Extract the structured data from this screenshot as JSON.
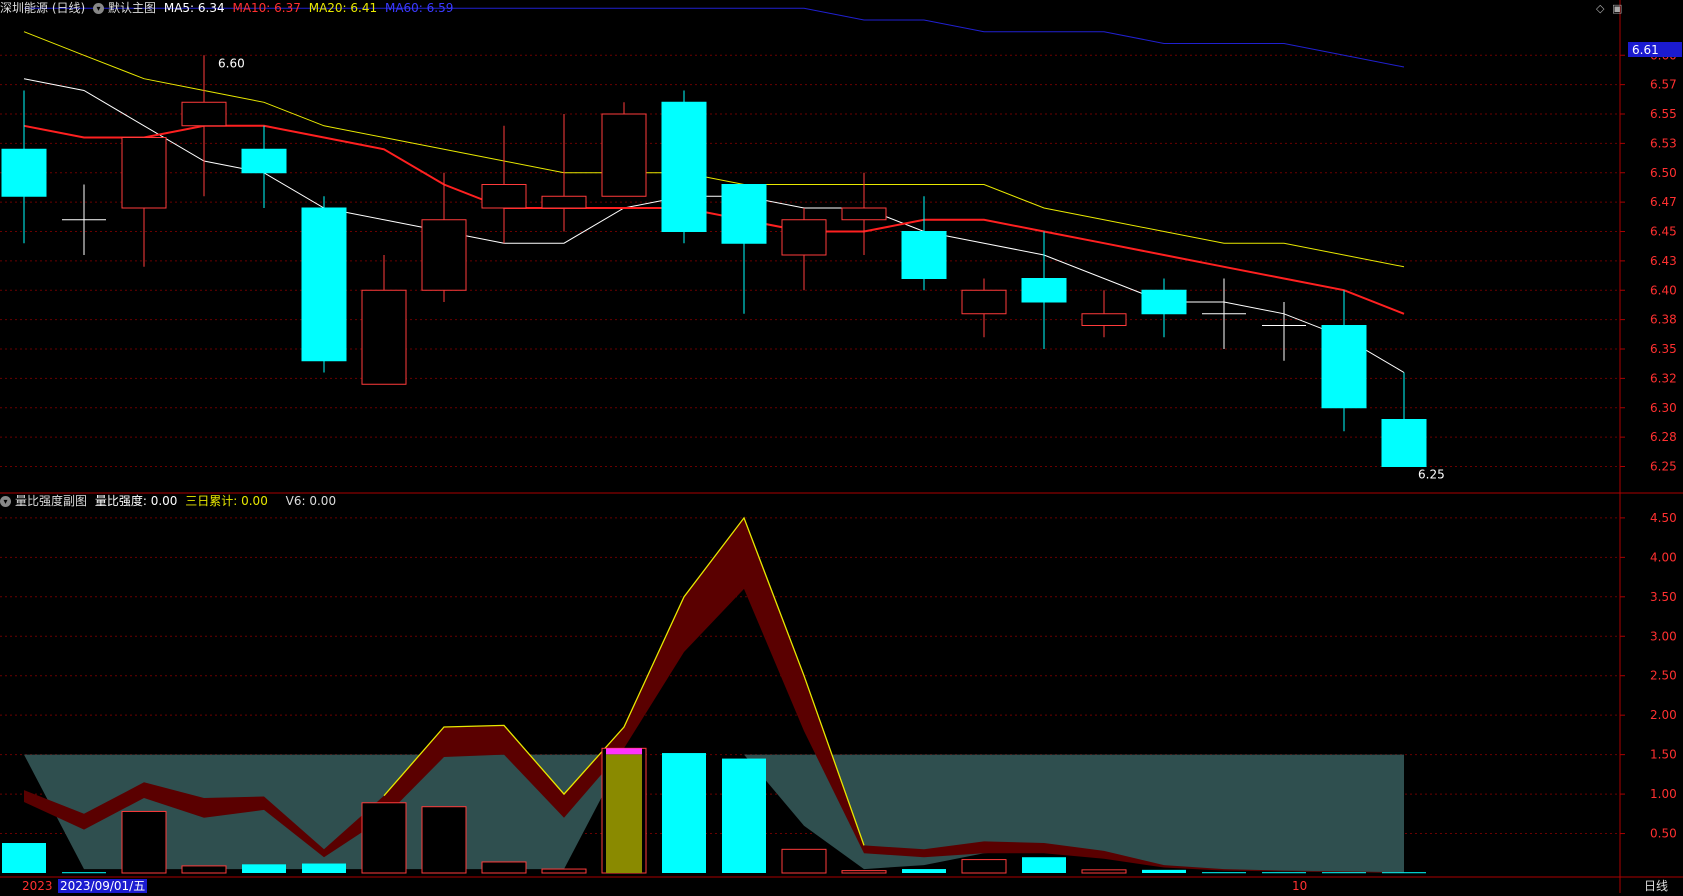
{
  "main_header": {
    "title": "深圳能源 (日线)",
    "chart_name": "默认主图",
    "ma5_label": "MA5: 6.34",
    "ma10_label": "MA10: 6.37",
    "ma20_label": "MA20: 6.41",
    "ma60_label": "MA60: 6.59"
  },
  "sub_header": {
    "title": "量比强度副图",
    "strength_label": "量比强度: 0.00",
    "three_day_label": "三日累计: 0.00",
    "v6_label": "V6: 0.00"
  },
  "colors": {
    "up": "#ff3b3b",
    "down": "#00ffff",
    "ma5": "#ffffff",
    "ma10": "#ff2020",
    "ma20": "#e8e800",
    "ma60": "#2020d0",
    "grid": "#6a0000",
    "band_fill": "#2f4f4f",
    "area_fill": "#5a0000",
    "area_line": "#e8e800"
  },
  "bottom_bar": {
    "year_label": "2023",
    "date_label": "2023/09/01/五",
    "month_label": "10",
    "period_label": "日线"
  },
  "current_price_tag": "6.61",
  "chart_data": [
    {
      "type": "candlestick",
      "title": "默认主图",
      "ylim": [
        6.23,
        6.63
      ],
      "y_ticks": [
        "6.60",
        "6.57",
        "6.55",
        "6.53",
        "6.50",
        "6.47",
        "6.45",
        "6.43",
        "6.40",
        "6.38",
        "6.35",
        "6.32",
        "6.30",
        "6.28",
        "6.25"
      ],
      "y_tick_values": [
        6.6,
        6.575,
        6.55,
        6.525,
        6.5,
        6.475,
        6.45,
        6.425,
        6.4,
        6.375,
        6.35,
        6.325,
        6.3,
        6.275,
        6.25
      ],
      "candles": [
        {
          "o": 6.52,
          "h": 6.57,
          "l": 6.44,
          "c": 6.48
        },
        {
          "o": 6.46,
          "h": 6.49,
          "l": 6.43,
          "c": 6.46
        },
        {
          "o": 6.47,
          "h": 6.53,
          "l": 6.42,
          "c": 6.53
        },
        {
          "o": 6.54,
          "h": 6.6,
          "l": 6.48,
          "c": 6.56
        },
        {
          "o": 6.52,
          "h": 6.54,
          "l": 6.47,
          "c": 6.5
        },
        {
          "o": 6.47,
          "h": 6.48,
          "l": 6.33,
          "c": 6.34
        },
        {
          "o": 6.32,
          "h": 6.43,
          "l": 6.32,
          "c": 6.4
        },
        {
          "o": 6.4,
          "h": 6.5,
          "l": 6.39,
          "c": 6.46
        },
        {
          "o": 6.47,
          "h": 6.54,
          "l": 6.44,
          "c": 6.49
        },
        {
          "o": 6.47,
          "h": 6.55,
          "l": 6.45,
          "c": 6.48
        },
        {
          "o": 6.48,
          "h": 6.56,
          "l": 6.48,
          "c": 6.55
        },
        {
          "o": 6.56,
          "h": 6.57,
          "l": 6.44,
          "c": 6.45
        },
        {
          "o": 6.49,
          "h": 6.49,
          "l": 6.38,
          "c": 6.44
        },
        {
          "o": 6.43,
          "h": 6.47,
          "l": 6.4,
          "c": 6.46
        },
        {
          "o": 6.46,
          "h": 6.5,
          "l": 6.43,
          "c": 6.47
        },
        {
          "o": 6.45,
          "h": 6.48,
          "l": 6.4,
          "c": 6.41
        },
        {
          "o": 6.38,
          "h": 6.41,
          "l": 6.36,
          "c": 6.4
        },
        {
          "o": 6.41,
          "h": 6.45,
          "l": 6.35,
          "c": 6.39
        },
        {
          "o": 6.37,
          "h": 6.4,
          "l": 6.36,
          "c": 6.38
        },
        {
          "o": 6.4,
          "h": 6.41,
          "l": 6.36,
          "c": 6.38
        },
        {
          "o": 6.38,
          "h": 6.41,
          "l": 6.35,
          "c": 6.38
        },
        {
          "o": 6.37,
          "h": 6.39,
          "l": 6.34,
          "c": 6.37
        },
        {
          "o": 6.37,
          "h": 6.4,
          "l": 6.28,
          "c": 6.3
        },
        {
          "o": 6.29,
          "h": 6.33,
          "l": 6.25,
          "c": 6.25
        }
      ],
      "series": [
        {
          "name": "MA5",
          "values": [
            6.58,
            6.57,
            6.54,
            6.51,
            6.5,
            6.47,
            6.46,
            6.45,
            6.44,
            6.44,
            6.47,
            6.48,
            6.48,
            6.47,
            6.47,
            6.45,
            6.44,
            6.43,
            6.41,
            6.39,
            6.39,
            6.38,
            6.36,
            6.33
          ]
        },
        {
          "name": "MA10",
          "values": [
            6.54,
            6.53,
            6.53,
            6.54,
            6.54,
            6.53,
            6.52,
            6.49,
            6.47,
            6.47,
            6.47,
            6.47,
            6.46,
            6.45,
            6.45,
            6.46,
            6.46,
            6.45,
            6.44,
            6.43,
            6.42,
            6.41,
            6.4,
            6.38
          ]
        },
        {
          "name": "MA20",
          "values": [
            6.62,
            6.6,
            6.58,
            6.57,
            6.56,
            6.54,
            6.53,
            6.52,
            6.51,
            6.5,
            6.5,
            6.5,
            6.49,
            6.49,
            6.49,
            6.49,
            6.49,
            6.47,
            6.46,
            6.45,
            6.44,
            6.44,
            6.43,
            6.42
          ]
        },
        {
          "name": "MA60",
          "values": [
            6.64,
            6.64,
            6.64,
            6.64,
            6.64,
            6.64,
            6.64,
            6.64,
            6.64,
            6.64,
            6.64,
            6.64,
            6.64,
            6.64,
            6.63,
            6.63,
            6.62,
            6.62,
            6.62,
            6.61,
            6.61,
            6.61,
            6.6,
            6.59
          ]
        }
      ],
      "annotations": [
        {
          "label": "6.60",
          "index": 3,
          "value": 6.6
        },
        {
          "label": "6.25",
          "index": 23,
          "value": 6.25
        }
      ]
    },
    {
      "type": "bar",
      "title": "量比强度副图",
      "ylim": [
        0,
        4.6
      ],
      "y_ticks": [
        "4.50",
        "4.00",
        "3.50",
        "3.00",
        "2.50",
        "2.00",
        "1.50",
        "1.00",
        "0.50"
      ],
      "y_tick_values": [
        4.5,
        4.0,
        3.5,
        3.0,
        2.5,
        2.0,
        1.5,
        1.0,
        0.5
      ],
      "values": [
        0.38,
        0.01,
        0.78,
        0.09,
        0.11,
        0.12,
        0.89,
        0.84,
        0.14,
        0.05,
        1.58,
        1.52,
        1.45,
        0.3,
        0.03,
        0.05,
        0.17,
        0.2,
        0.04,
        0.04,
        0.01,
        0.01,
        0.01,
        0.01
      ],
      "bar_colors": [
        "down",
        "down",
        "up",
        "up",
        "down",
        "down",
        "up",
        "up",
        "up",
        "up",
        "olive",
        "down",
        "down",
        "up",
        "up",
        "down",
        "up",
        "down",
        "up",
        "down",
        "down",
        "down",
        "down",
        "down"
      ],
      "band_top": 1.5,
      "area_upper": [
        1.05,
        0.75,
        1.15,
        0.95,
        0.97,
        0.3,
        0.98,
        1.85,
        1.87,
        1.0,
        1.85,
        3.5,
        4.5,
        2.5,
        0.35,
        0.3,
        0.4,
        0.38,
        0.28,
        0.1,
        0.05,
        0.03,
        0.02,
        0.01
      ],
      "area_lower": [
        0.9,
        0.55,
        0.95,
        0.7,
        0.8,
        0.2,
        0.7,
        1.47,
        1.5,
        0.7,
        1.58,
        2.8,
        3.6,
        1.8,
        0.25,
        0.2,
        0.25,
        0.25,
        0.18,
        0.07,
        0.03,
        0.02,
        0.01,
        0.0
      ],
      "band_lower": [
        1.5,
        0.05,
        0.05,
        0.05,
        0.05,
        0.05,
        0.05,
        0.05,
        0.05,
        0.05,
        1.5,
        1.5,
        1.5,
        0.6,
        0.05,
        0.1,
        0.25,
        0.3,
        0.2,
        0.08,
        0.04,
        0.02,
        0.01,
        0.0
      ]
    }
  ]
}
